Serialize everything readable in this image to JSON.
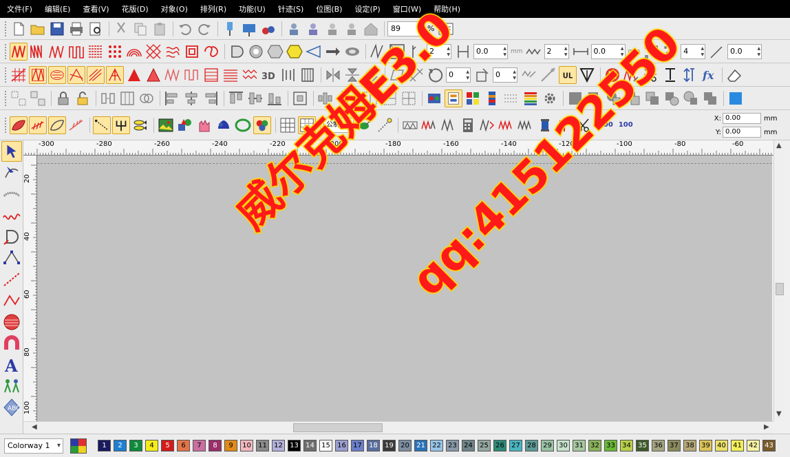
{
  "menu": [
    "文件(F)",
    "编辑(E)",
    "查看(V)",
    "花版(D)",
    "对象(O)",
    "排列(R)",
    "功能(U)",
    "针迹(S)",
    "位图(B)",
    "设定(P)",
    "窗口(W)",
    "帮助(H)"
  ],
  "toolbar1": {
    "zoom_value": "89",
    "zoom_unit": "%"
  },
  "toolbar2": {
    "spin1": "2",
    "spin2": "0.0",
    "unit_mm1": "mm",
    "spin3": "2",
    "spin4": "0.0",
    "unit_mm2": "mm",
    "spin5": "4",
    "spin6": "0.0"
  },
  "toolbar3": {
    "spin1": "0",
    "spin2": "0"
  },
  "toolbar5": {
    "unit_select": "公制",
    "label_1000": "1000",
    "label_100": "100",
    "x_label": "X:",
    "x_value": "0.00",
    "x_unit": "mm",
    "y_label": "Y:",
    "y_value": "0.00",
    "y_unit": "mm"
  },
  "ruler_h": [
    "-300",
    "-280",
    "-260",
    "-240",
    "-220",
    "-200",
    "-180",
    "-160",
    "-140",
    "-120",
    "-100",
    "-80",
    "-60"
  ],
  "ruler_v": [
    "20",
    "40",
    "60",
    "80",
    "100"
  ],
  "watermark": {
    "line1": "威尔克姆E3.0",
    "line2": "qq:415122550"
  },
  "colorway": "Colorway 1",
  "swatches": [
    {
      "n": "1",
      "c": "#1a1a5e",
      "t": "#ffffff"
    },
    {
      "n": "2",
      "c": "#1e7fd1",
      "t": "#ffffff"
    },
    {
      "n": "3",
      "c": "#0f8a3a",
      "t": "#ffffff"
    },
    {
      "n": "4",
      "c": "#f4ec1a",
      "t": "#000000"
    },
    {
      "n": "5",
      "c": "#d21c1c",
      "t": "#ffffff"
    },
    {
      "n": "6",
      "c": "#e2744a",
      "t": "#000000"
    },
    {
      "n": "7",
      "c": "#c86ea0",
      "t": "#000000"
    },
    {
      "n": "8",
      "c": "#9a2f6a",
      "t": "#ffffff"
    },
    {
      "n": "9",
      "c": "#e08a18",
      "t": "#000000"
    },
    {
      "n": "10",
      "c": "#f2b8c0",
      "t": "#000000"
    },
    {
      "n": "11",
      "c": "#8a8a8a",
      "t": "#000000"
    },
    {
      "n": "12",
      "c": "#b2b0d8",
      "t": "#000000"
    },
    {
      "n": "13",
      "c": "#000000",
      "t": "#ffffff"
    },
    {
      "n": "14",
      "c": "#6e6e6e",
      "t": "#ffffff"
    },
    {
      "n": "15",
      "c": "#ffffff",
      "t": "#000000"
    },
    {
      "n": "16",
      "c": "#9a9ed0",
      "t": "#000000"
    },
    {
      "n": "17",
      "c": "#6a7ec8",
      "t": "#000000"
    },
    {
      "n": "18",
      "c": "#5a6e9e",
      "t": "#ffffff"
    },
    {
      "n": "19",
      "c": "#3a3a3a",
      "t": "#ffffff"
    },
    {
      "n": "20",
      "c": "#7e8ea2",
      "t": "#000000"
    },
    {
      "n": "21",
      "c": "#2a72b8",
      "t": "#ffffff"
    },
    {
      "n": "22",
      "c": "#96c4e8",
      "t": "#000000"
    },
    {
      "n": "23",
      "c": "#8898a8",
      "t": "#000000"
    },
    {
      "n": "24",
      "c": "#6e8488",
      "t": "#000000"
    },
    {
      "n": "25",
      "c": "#94a6a0",
      "t": "#000000"
    },
    {
      "n": "26",
      "c": "#2e8a78",
      "t": "#000000"
    },
    {
      "n": "27",
      "c": "#4ab4c0",
      "t": "#000000"
    },
    {
      "n": "28",
      "c": "#5e9a96",
      "t": "#000000"
    },
    {
      "n": "29",
      "c": "#9ac2a4",
      "t": "#000000"
    },
    {
      "n": "30",
      "c": "#c8e2cc",
      "t": "#000000"
    },
    {
      "n": "31",
      "c": "#a6c8a0",
      "t": "#000000"
    },
    {
      "n": "32",
      "c": "#8ab25a",
      "t": "#000000"
    },
    {
      "n": "33",
      "c": "#6ab838",
      "t": "#000000"
    },
    {
      "n": "34",
      "c": "#b8d04a",
      "t": "#000000"
    },
    {
      "n": "35",
      "c": "#3e5a2a",
      "t": "#ffffff"
    },
    {
      "n": "36",
      "c": "#a4a482",
      "t": "#000000"
    },
    {
      "n": "37",
      "c": "#8a8a5e",
      "t": "#000000"
    },
    {
      "n": "38",
      "c": "#b4a878",
      "t": "#000000"
    },
    {
      "n": "39",
      "c": "#dcc45a",
      "t": "#000000"
    },
    {
      "n": "40",
      "c": "#ece06a",
      "t": "#000000"
    },
    {
      "n": "41",
      "c": "#f4ee5a",
      "t": "#000000"
    },
    {
      "n": "42",
      "c": "#f6f2a4",
      "t": "#000000"
    },
    {
      "n": "43",
      "c": "#7a5a2a",
      "t": "#ffffff"
    }
  ]
}
